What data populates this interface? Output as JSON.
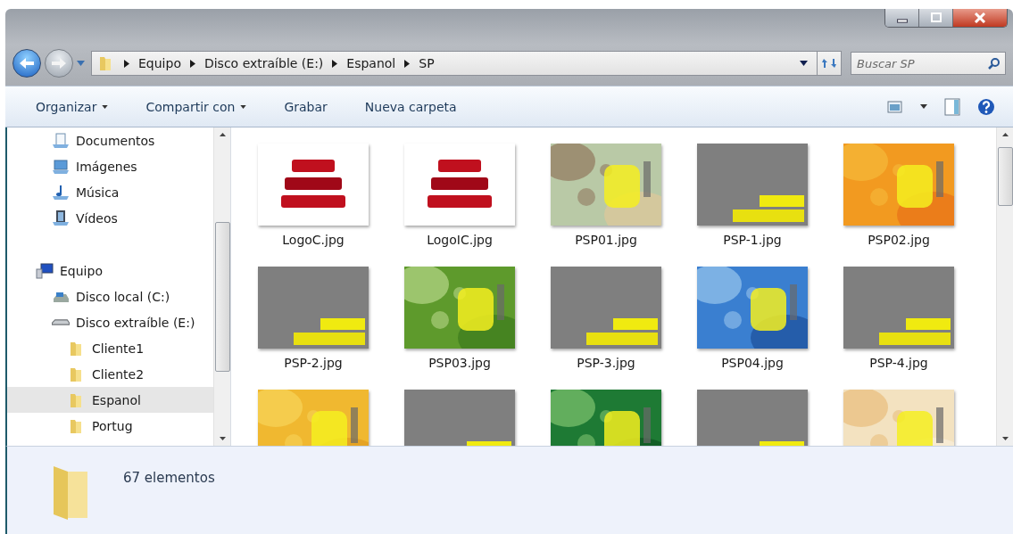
{
  "address_bar": {
    "crumbs": [
      "Equipo",
      "Disco extraíble (E:)",
      "Espanol",
      "SP"
    ]
  },
  "search": {
    "placeholder": "Buscar SP"
  },
  "toolbar": {
    "items": [
      {
        "label": "Organizar",
        "dropdown": true
      },
      {
        "label": "Compartir con",
        "dropdown": true
      },
      {
        "label": "Grabar",
        "dropdown": false
      },
      {
        "label": "Nueva carpeta",
        "dropdown": false
      }
    ]
  },
  "navigation": {
    "libraries": [
      {
        "label": "Documentos",
        "kind": "documents",
        "selected": false
      },
      {
        "label": "Imágenes",
        "kind": "pictures",
        "selected": false
      },
      {
        "label": "Música",
        "kind": "music",
        "selected": false
      },
      {
        "label": "Vídeos",
        "kind": "videos",
        "selected": false
      }
    ],
    "computer": [
      {
        "label": "Equipo",
        "kind": "computer",
        "selected": false,
        "children": [
          {
            "label": "Disco local (C:)",
            "kind": "disk",
            "selected": false
          },
          {
            "label": "Disco extraíble (E:)",
            "kind": "removable",
            "selected": false,
            "children": [
              {
                "label": "Cliente1",
                "kind": "folder",
                "selected": false
              },
              {
                "label": "Cliente2",
                "kind": "folder",
                "selected": false
              },
              {
                "label": "Espanol",
                "kind": "folder",
                "selected": true
              },
              {
                "label": "Portug",
                "kind": "folder",
                "selected": false
              }
            ]
          }
        ]
      }
    ]
  },
  "files": [
    {
      "name": "LogoC.jpg",
      "kind": "picture"
    },
    {
      "name": "LogoIC.jpg",
      "kind": "picture"
    },
    {
      "name": "PSP01.jpg",
      "kind": "picture"
    },
    {
      "name": "PSP-1.jpg",
      "kind": "picture"
    },
    {
      "name": "PSP02.jpg",
      "kind": "picture"
    },
    {
      "name": "PSP-2.jpg",
      "kind": "picture"
    },
    {
      "name": "PSP03.jpg",
      "kind": "picture"
    },
    {
      "name": "PSP-3.jpg",
      "kind": "picture"
    },
    {
      "name": "PSP04.jpg",
      "kind": "picture"
    },
    {
      "name": "PSP-4.jpg",
      "kind": "picture"
    },
    {
      "kind": "picture"
    },
    {
      "kind": "picture"
    },
    {
      "kind": "picture"
    },
    {
      "kind": "picture"
    },
    {
      "kind": "picture"
    }
  ],
  "status_bar": {
    "count": "67 elementos"
  }
}
